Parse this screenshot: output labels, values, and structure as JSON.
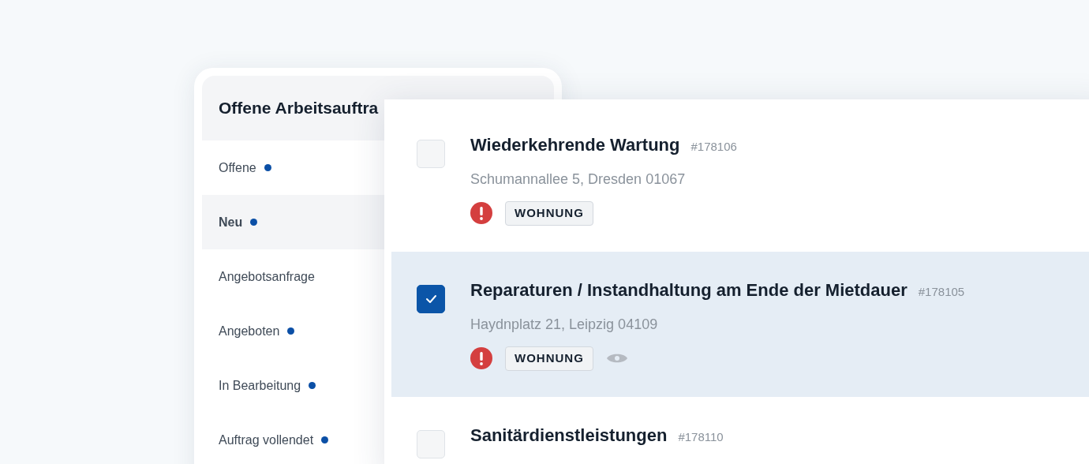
{
  "list_panel": {
    "title": "Offene Arbeitsauftra",
    "filters": [
      {
        "label": "Offene",
        "selected": false,
        "dot": true
      },
      {
        "label": "Neu",
        "selected": true,
        "dot": true
      },
      {
        "label": "Angebotsanfrage",
        "selected": false,
        "dot": false
      },
      {
        "label": "Angeboten",
        "selected": false,
        "dot": true
      },
      {
        "label": "In Bearbeitung",
        "selected": false,
        "dot": true
      },
      {
        "label": "Auftrag vollendet",
        "selected": false,
        "dot": true
      }
    ]
  },
  "orders": [
    {
      "title": "Wiederkehrende Wartung",
      "number": "#178106",
      "address": "Schumannallee 5, Dresden 01067",
      "tag": "WOHNUNG",
      "urgent": true,
      "viewed": false,
      "checked": false
    },
    {
      "title": "Reparaturen / Instandhaltung am Ende der Mietdauer",
      "number": "#178105",
      "address": "Haydnplatz 21, Leipzig 04109",
      "tag": "WOHNUNG",
      "urgent": true,
      "viewed": true,
      "checked": true
    },
    {
      "title": "Sanitärdienstleistungen",
      "number": "#178110",
      "checked": false,
      "urgent": false,
      "viewed": false
    }
  ]
}
